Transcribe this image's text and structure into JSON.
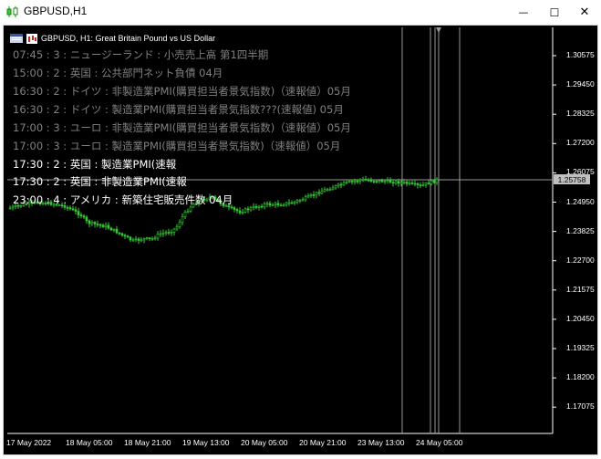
{
  "window": {
    "title": "GBPUSD,H1",
    "minimize_glyph": "—",
    "maximize_glyph": "☐",
    "close_glyph": "✕"
  },
  "chart": {
    "header": "GBPUSD, H1:  Great Britain Pound vs US Dollar",
    "current_price": "1.25758",
    "candle_color": "#33cc33",
    "background": "#000000",
    "y_ticks": [
      "1.30575",
      "1.29450",
      "1.28325",
      "1.27200",
      "1.26075",
      "1.24950",
      "1.23825",
      "1.22700",
      "1.21575",
      "1.20450",
      "1.19325",
      "1.18200",
      "1.17075"
    ],
    "x_ticks": [
      "17 May 2022",
      "18 May 05:00",
      "18 May 21:00",
      "19 May 13:00",
      "20 May 05:00",
      "20 May 21:00",
      "23 May 13:00",
      "24 May 05:00"
    ]
  },
  "news": [
    {
      "text": "07:45 : 3 : ニュージーランド : 小売売上高 第1四半期",
      "color": "#808080"
    },
    {
      "text": "15:00 : 2 : 英国 : 公共部門ネット負債 04月",
      "color": "#808080"
    },
    {
      "text": "16:30 : 2 : ドイツ : 非製造業PMI(購買担当者景気指数)（速報値）05月",
      "color": "#808080"
    },
    {
      "text": "16:30 : 2 : ドイツ : 製造業PMI(購買担当者景気指数???(速報値) 05月",
      "color": "#808080"
    },
    {
      "text": "17:00 : 3 : ユーロ : 非製造業PMI(購買担当者景気指数)（速報値）05月",
      "color": "#808080"
    },
    {
      "text": "17:00 : 3 : ユーロ : 製造業PMI(購買担当者景気指数)（速報値）05月",
      "color": "#808080"
    },
    {
      "text": "17:30 : 2 : 英国 : 製造業PMI(速報",
      "color": "#ffffff"
    },
    {
      "text": "17:30 : 2 : 英国 : 非製造業PMI(速報",
      "color": "#ffffff"
    },
    {
      "text": "23:00 : 4 : アメリカ : 新築住宅販売件数 04月",
      "color": "#ffffff"
    }
  ]
}
